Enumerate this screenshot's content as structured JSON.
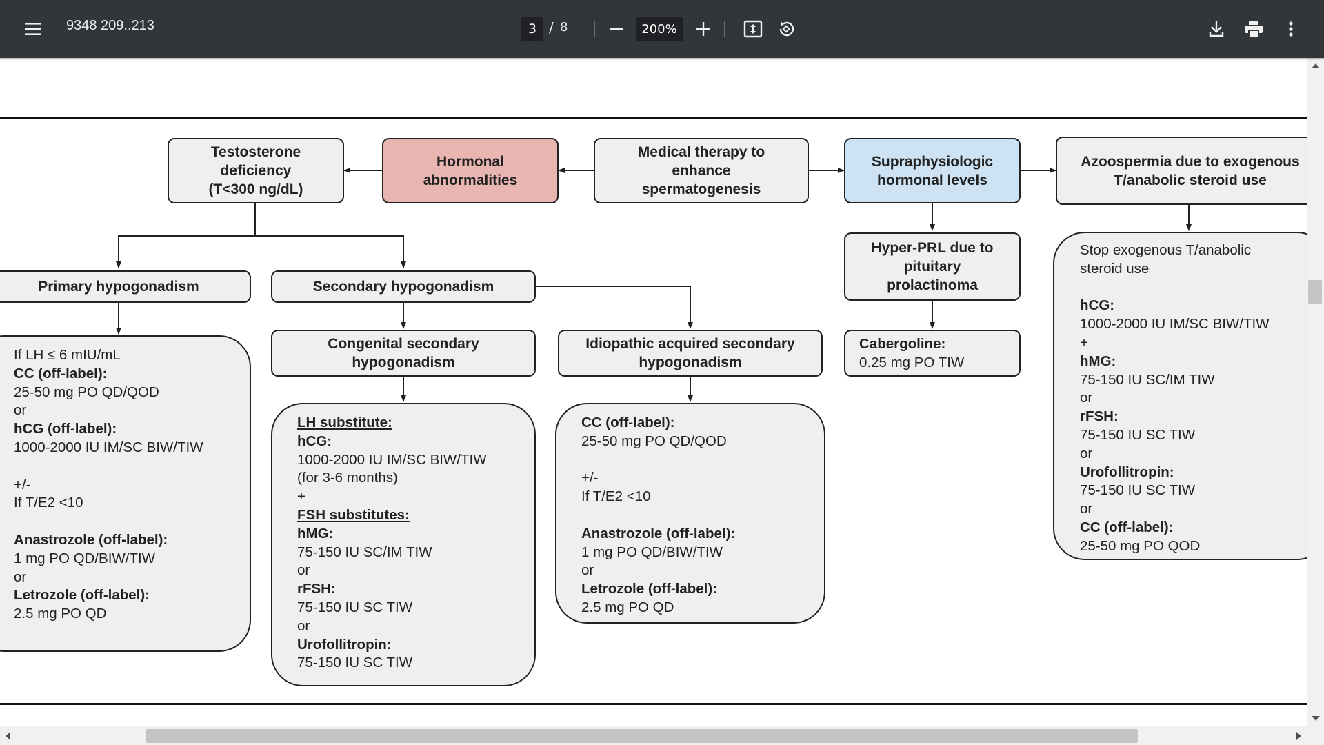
{
  "toolbar": {
    "title": "9348 209..213",
    "page_current": "3",
    "page_separator": "/",
    "page_total": "8",
    "zoom": "200%",
    "icons": [
      "menu-icon",
      "minus-icon",
      "plus-icon",
      "fit-page-icon",
      "rotate-icon",
      "download-icon",
      "print-icon",
      "more-vert-icon"
    ]
  },
  "colors": {
    "toolbar_bg": "#323639",
    "hormonal_box": "#e8b5b1",
    "supraphysiologic_box": "#cde3f3",
    "box_fill": "#efefef"
  },
  "flowchart": {
    "testosterone_deficiency": [
      "Testosterone",
      "deficiency",
      "(T<300 ng/dL)"
    ],
    "hormonal_abnormalities": [
      "Hormonal",
      "abnormalities"
    ],
    "medical_therapy": [
      "Medical therapy to",
      "enhance",
      "spermatogenesis"
    ],
    "supraphysiologic": [
      "Supraphysiologic",
      "hormonal levels"
    ],
    "azoospermia": [
      "Azoospermia due to exogenous",
      "T/anabolic steroid use"
    ],
    "primary_hypogonadism": "Primary hypogonadism",
    "secondary_hypogonadism": "Secondary hypogonadism",
    "congenital_secondary": [
      "Congenital secondary",
      "hypogonadism"
    ],
    "idiopathic_secondary": [
      "Idiopathic acquired secondary",
      "hypogonadism"
    ],
    "hyper_prl": [
      "Hyper-PRL due to",
      "pituitary",
      "prolactinoma"
    ],
    "cabergoline": {
      "drug": "Cabergoline:",
      "dose": "0.25 mg PO TIW"
    },
    "primary_panel": [
      {
        "t": "n",
        "v": "If LH ≤ 6 mIU/mL"
      },
      {
        "t": "b",
        "v": "CC (off-label):"
      },
      {
        "t": "n",
        "v": "25-50 mg PO QD/QOD"
      },
      {
        "t": "n",
        "v": "or"
      },
      {
        "t": "b",
        "v": "hCG (off-label):"
      },
      {
        "t": "n",
        "v": "1000-2000 IU IM/SC BIW/TIW"
      },
      {
        "t": "gap",
        "v": ""
      },
      {
        "t": "n",
        "v": "+/-"
      },
      {
        "t": "n",
        "v": "If T/E2 <10"
      },
      {
        "t": "gap",
        "v": ""
      },
      {
        "t": "b",
        "v": "Anastrozole (off-label):"
      },
      {
        "t": "n",
        "v": "1 mg PO QD/BIW/TIW"
      },
      {
        "t": "n",
        "v": "or"
      },
      {
        "t": "b",
        "v": "Letrozole (off-label):"
      },
      {
        "t": "n",
        "v": "2.5 mg PO QD"
      }
    ],
    "congenital_panel": [
      {
        "t": "u",
        "v": "LH substitute:"
      },
      {
        "t": "b",
        "v": "hCG:"
      },
      {
        "t": "n",
        "v": "1000-2000 IU IM/SC BIW/TIW"
      },
      {
        "t": "n",
        "v": "(for 3-6 months)"
      },
      {
        "t": "n",
        "v": "+"
      },
      {
        "t": "u",
        "v": "FSH substitutes:"
      },
      {
        "t": "b",
        "v": "hMG:"
      },
      {
        "t": "n",
        "v": "75-150 IU SC/IM TIW"
      },
      {
        "t": "n",
        "v": "or"
      },
      {
        "t": "b",
        "v": "rFSH:"
      },
      {
        "t": "n",
        "v": "75-150 IU SC TIW"
      },
      {
        "t": "n",
        "v": "or"
      },
      {
        "t": "b",
        "v": "Urofollitropin:"
      },
      {
        "t": "n",
        "v": "75-150 IU SC TIW"
      }
    ],
    "idiopathic_panel": [
      {
        "t": "b",
        "v": "CC (off-label):"
      },
      {
        "t": "n",
        "v": "25-50 mg PO QD/QOD"
      },
      {
        "t": "gap",
        "v": ""
      },
      {
        "t": "n",
        "v": "+/-"
      },
      {
        "t": "n",
        "v": "If T/E2 <10"
      },
      {
        "t": "gap",
        "v": ""
      },
      {
        "t": "b",
        "v": "Anastrozole (off-label):"
      },
      {
        "t": "n",
        "v": "1 mg PO QD/BIW/TIW"
      },
      {
        "t": "n",
        "v": "or"
      },
      {
        "t": "b",
        "v": "Letrozole (off-label):"
      },
      {
        "t": "n",
        "v": "2.5 mg PO QD"
      }
    ],
    "azoospermia_panel": [
      {
        "t": "n",
        "v": "Stop exogenous T/anabolic"
      },
      {
        "t": "n",
        "v": "steroid use"
      },
      {
        "t": "gap",
        "v": ""
      },
      {
        "t": "b",
        "v": "hCG:"
      },
      {
        "t": "n",
        "v": "1000-2000 IU IM/SC BIW/TIW"
      },
      {
        "t": "n",
        "v": "+"
      },
      {
        "t": "b",
        "v": "hMG:"
      },
      {
        "t": "n",
        "v": "75-150 IU SC/IM TIW"
      },
      {
        "t": "n",
        "v": "or"
      },
      {
        "t": "b",
        "v": "rFSH:"
      },
      {
        "t": "n",
        "v": "75-150 IU SC TIW"
      },
      {
        "t": "n",
        "v": "or"
      },
      {
        "t": "b",
        "v": "Urofollitropin:"
      },
      {
        "t": "n",
        "v": "75-150 IU SC TIW"
      },
      {
        "t": "n",
        "v": "or"
      },
      {
        "t": "b",
        "v": "CC (off-label):"
      },
      {
        "t": "n",
        "v": "25-50 mg PO QOD"
      }
    ]
  }
}
